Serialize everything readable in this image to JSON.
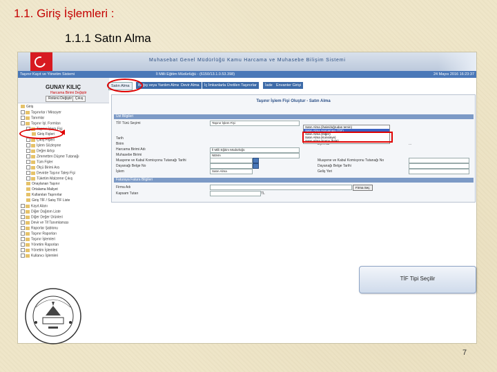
{
  "slide": {
    "title": "1.1. Giriş İşlemleri :",
    "subtitle": "1.1.1  Satın Alma",
    "page_number": "7",
    "caption": "TİF Tipi Seçilir"
  },
  "app": {
    "banner_title": "Muhasebat Genel Müdürlüğü Kamu Harcama ve Muhasebe Bilişim Sistemi",
    "system_name": "Taşınır Kayıt ve Yönetim Sistemi",
    "unit_info": "İl Milli Eğitim Müdürlüğü - (6150/13.1.0.53.398)",
    "date": "24 Mayıs 2016 16:23:37"
  },
  "user": {
    "name": "GUNAY KILIÇ",
    "change_unit": "Harcama Birimi Değiştir",
    "btn_change_role": "Rolünü Değiştir",
    "btn_logout": "Çıkış"
  },
  "tabs": [
    "Satın Alma",
    "Bağış veya Yardım Alma",
    "Devir Alma",
    "İç İmkanlarla Üretilen Taşınırlar",
    "İade",
    "Envanter Girişi"
  ],
  "tree": [
    "Giriş",
    "Taşınırlar / Mirasyer",
    "Tanımlar",
    "Taşınır İşl. Formları",
    "Taşınır İşlem Fişi",
    "Giriş Fişleri",
    "Çıkış Fişleri",
    "İşlem Sözleşme",
    "Değer Artışı",
    "Zimmetten Düşme Tutanağı",
    "Tüm Fişler",
    "Ölçü Birimi Ara",
    "Devirde Taşınır Talep Fişi",
    "Tüketim Malzeme Çıkış",
    "Onaylanan Taşınır",
    "Ortalama Maliyet",
    "Kullanılan Taşınırlar",
    "Giriş TİF / Satış TİF Liste",
    "Kayıt Alanı",
    "Diğer Dağıtım Liste",
    "Diğer Değer Ürünleri",
    "Devir ve Tif Tanımlaması",
    "Raporlar Şablonu",
    "Taşınır Raporları",
    "Taşınır İşlemleri",
    "Yönetim Raporları",
    "Yönetim İşlemleri",
    "Kullanıcı İşlemleri"
  ],
  "form": {
    "panel_title": "Taşınır İşlem Fişi Oluştur - Satın Alma",
    "section1": "Üst Bilgileri",
    "section2": "Faturaya Fatura Bilgileri",
    "labels": {
      "tif_tipi": "TİF Türü Seçimi",
      "tarih": "Tarih",
      "birim": "Birim",
      "harcama_birimi": "Harcama Birimi Adı",
      "muhasebe_birimi": "Muhasebe Birimi",
      "muayene_kabul": "Muayene ve Kabul Komisyonu Tutanağı Tarihi",
      "dayanak_belge": "Dayanağı Belge No",
      "islem": "İşlem",
      "firma_adi": "Firma Adı",
      "kapsam": "Kapsam Tutarı",
      "dyn_adi": "Dyn Adı",
      "muayene_no": "Muayene ve Kabul Komisyonu Tutanağı No",
      "dayanak_tarih": "Dayanağı Belge Tarihi",
      "gelis_yeri": "Geliş Yeri"
    },
    "tif_selected": "Taşınır İşlem Fişi",
    "dropdown_options": [
      "Satın Alma (ihale/doğrudan temin)",
      "Satın Alma Harcaması (TİF)",
      "Satın Alma (Diğer)",
      "Satın Alma (Konsinye)",
      "Satın Alma (Kamu İhale)"
    ],
    "values": {
      "birim": "İl Milli Eğitim Müdürlüğü",
      "muhasebe": "NEMA",
      "islem": "Satın Alma",
      "kapsam_unit": "TL",
      "dyn_suffix": "..."
    },
    "firma_btn": "Firma Seç"
  }
}
